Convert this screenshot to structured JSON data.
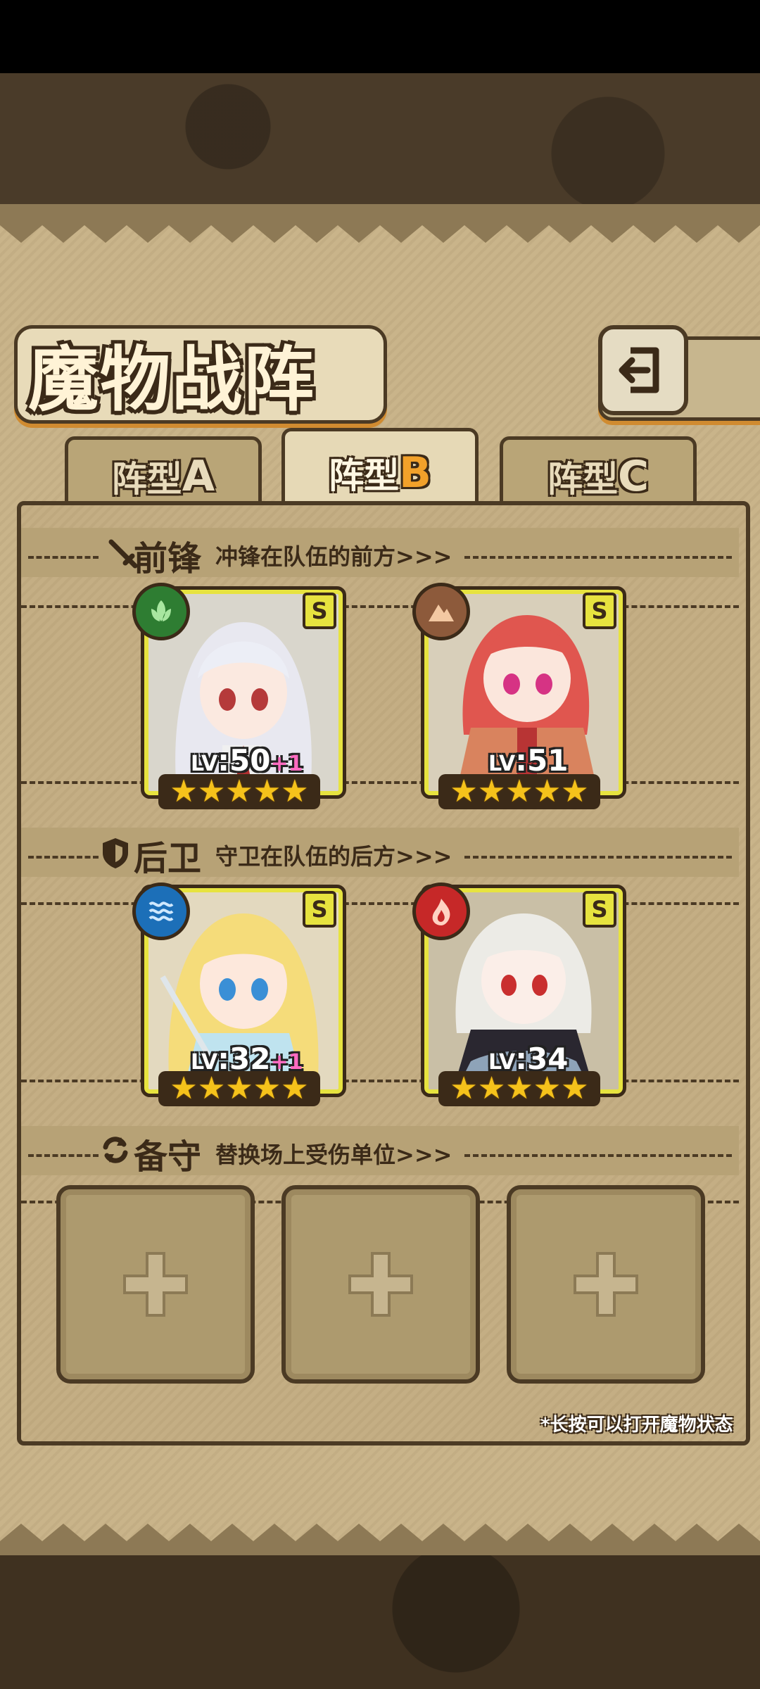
{
  "title": "魔物战阵",
  "tabs": [
    {
      "label": "阵型",
      "letter": "A",
      "active": false
    },
    {
      "label": "阵型",
      "letter": "B",
      "active": true
    },
    {
      "label": "阵型",
      "letter": "C",
      "active": false
    }
  ],
  "sections": {
    "front": {
      "title": "前锋",
      "subtitle": "冲锋在队伍的前方>>>",
      "icon": "sword-icon"
    },
    "back": {
      "title": "后卫",
      "subtitle": "守卫在队伍的后方>>>",
      "icon": "shield-icon"
    },
    "reserve": {
      "title": "备守",
      "subtitle": "替换场上受伤单位>>>",
      "icon": "swap-icon"
    }
  },
  "units": [
    {
      "rank": "S",
      "element": "leaf",
      "lv_prefix": "LV",
      "lv_value": ":50",
      "bonus": "+1",
      "stars": 5,
      "element_color": "#2e7d32"
    },
    {
      "rank": "S",
      "element": "earth",
      "lv_prefix": "LV",
      "lv_value": ":51",
      "bonus": "",
      "stars": 5,
      "element_color": "#8d5a3b"
    },
    {
      "rank": "S",
      "element": "water",
      "lv_prefix": "LV",
      "lv_value": ":32",
      "bonus": "+1",
      "stars": 5,
      "element_color": "#1c6fb8"
    },
    {
      "rank": "S",
      "element": "fire",
      "lv_prefix": "LV",
      "lv_value": ":34",
      "bonus": "",
      "stars": 5,
      "element_color": "#c62828"
    }
  ],
  "reserve_slots": [
    "empty",
    "empty",
    "empty"
  ],
  "hint": "*长按可以打开魔物状态"
}
